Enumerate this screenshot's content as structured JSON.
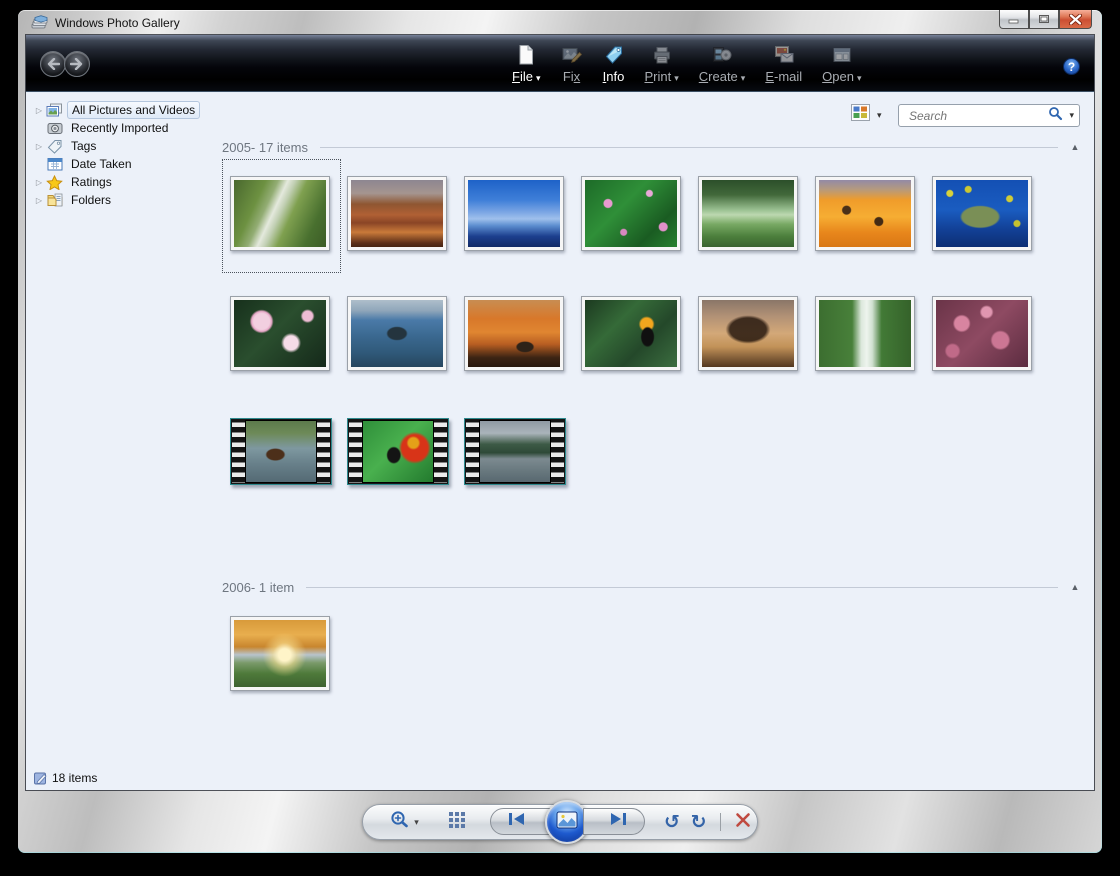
{
  "window": {
    "title": "Windows Photo Gallery",
    "caption_buttons": [
      "minimize",
      "maximize",
      "close"
    ]
  },
  "toolbar": {
    "back": "back",
    "forward": "forward",
    "items": [
      {
        "pre": "",
        "u": "F",
        "post": "ile",
        "arrow_glyph": "▾",
        "icon": "file-icon",
        "bright": true
      },
      {
        "pre": "Fi",
        "u": "x",
        "post": "",
        "arrow_glyph": "",
        "icon": "fix-icon",
        "bright": false
      },
      {
        "pre": "",
        "u": "I",
        "post": "nfo",
        "arrow_glyph": "",
        "icon": "info-icon",
        "bright": true
      },
      {
        "pre": "",
        "u": "P",
        "post": "rint",
        "arrow_glyph": "▾",
        "icon": "print-icon",
        "bright": false
      },
      {
        "pre": "",
        "u": "C",
        "post": "reate",
        "arrow_glyph": "▾",
        "icon": "create-icon",
        "bright": false
      },
      {
        "pre": "",
        "u": "E",
        "post": "-mail",
        "arrow_glyph": "",
        "icon": "email-icon",
        "bright": false
      },
      {
        "pre": "",
        "u": "O",
        "post": "pen",
        "arrow_glyph": "▾",
        "icon": "open-icon",
        "bright": false
      }
    ],
    "help_glyph": "?"
  },
  "sidebar": {
    "items": [
      {
        "label": "All Pictures and Videos",
        "expander_glyph": "▷",
        "icon": "photos-icon",
        "selected": true
      },
      {
        "label": "Recently Imported",
        "expander_glyph": "",
        "icon": "camera-icon",
        "selected": false
      },
      {
        "label": "Tags",
        "expander_glyph": "▷",
        "icon": "tag-icon",
        "selected": false
      },
      {
        "label": "Date Taken",
        "expander_glyph": "",
        "icon": "calendar-icon",
        "selected": false
      },
      {
        "label": "Ratings",
        "expander_glyph": "▷",
        "icon": "star-icon",
        "selected": false
      },
      {
        "label": "Folders",
        "expander_glyph": "▷",
        "icon": "folder-icon",
        "selected": false
      }
    ]
  },
  "search": {
    "placeholder": "Search",
    "dropdown_glyph": "▾",
    "view_dropdown_glyph": "▾"
  },
  "gallery": {
    "collapse_glyph": "▲",
    "groups": [
      {
        "label": "2005- 17 items",
        "items": [
          {
            "art": "creek",
            "kind": "photo",
            "selected": true
          },
          {
            "art": "desert",
            "kind": "photo",
            "selected": false
          },
          {
            "art": "dock",
            "kind": "photo",
            "selected": false
          },
          {
            "art": "forestflowers",
            "kind": "photo",
            "selected": false
          },
          {
            "art": "forest",
            "kind": "photo",
            "selected": false
          },
          {
            "art": "garden",
            "kind": "photo",
            "selected": false
          },
          {
            "art": "turtle",
            "kind": "photo",
            "selected": false
          },
          {
            "art": "frangipani",
            "kind": "photo",
            "selected": false
          },
          {
            "art": "whale",
            "kind": "photo",
            "selected": false
          },
          {
            "art": "oryx",
            "kind": "photo",
            "selected": false
          },
          {
            "art": "toucan",
            "kind": "photo",
            "selected": false
          },
          {
            "art": "tree",
            "kind": "photo",
            "selected": false
          },
          {
            "art": "waterfall",
            "kind": "photo",
            "selected": false
          },
          {
            "art": "winterleaves",
            "kind": "photo",
            "selected": false
          },
          {
            "art": "bear",
            "kind": "video",
            "selected": false
          },
          {
            "art": "butterfly",
            "kind": "video",
            "selected": false
          },
          {
            "art": "lake",
            "kind": "video",
            "selected": false
          }
        ]
      },
      {
        "label": "2006- 1 item",
        "items": [
          {
            "art": "autumn",
            "kind": "photo",
            "selected": false
          }
        ]
      }
    ]
  },
  "statusbar": {
    "text": "18 items"
  },
  "controlbar": {
    "zoom_arrow_glyph": "▾",
    "rotate_ccw_glyph": "↺",
    "rotate_cw_glyph": "↻"
  },
  "colors": {
    "accent_blue": "#2f66b0",
    "content_bg": "#ecf1f9",
    "toolbar_dark": "#0a0c10",
    "delete_red": "#bf4a40",
    "video_border_teal": "#2e8a8e",
    "close_button": "#cc4f33"
  }
}
